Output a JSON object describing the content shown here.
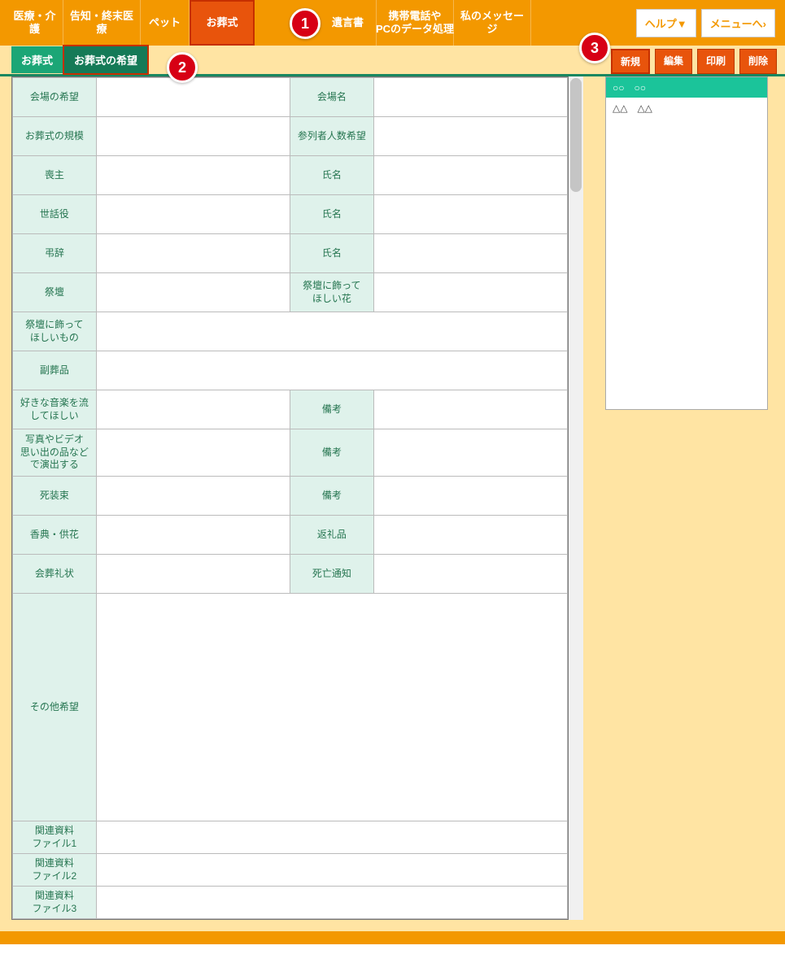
{
  "topnav": {
    "items": [
      "医療・介護",
      "告知・終末医療",
      "ペット",
      "お葬式",
      "",
      "遺言書",
      "携帯電話や\nPCのデータ処理",
      "私のメッセージ"
    ],
    "active_index": 3,
    "help": "ヘルプ▼",
    "menu": "メニューへ›"
  },
  "subtabs": {
    "items": [
      "お葬式",
      "お葬式の希望"
    ],
    "active_index": 1
  },
  "action_buttons": [
    "新規",
    "編集",
    "印刷",
    "削除"
  ],
  "callouts": [
    "1",
    "2",
    "3"
  ],
  "form_rows": [
    {
      "l1": "会場の希望",
      "l2": "会場名"
    },
    {
      "l1": "お葬式の規模",
      "l2": "参列者人数希望"
    },
    {
      "l1": "喪主",
      "l2": "氏名"
    },
    {
      "l1": "世話役",
      "l2": "氏名"
    },
    {
      "l1": "弔辞",
      "l2": "氏名"
    },
    {
      "l1": "祭壇",
      "l2": "祭壇に飾って\nほしい花"
    }
  ],
  "wide_rows": [
    "祭壇に飾って\nほしいもの",
    "副葬品"
  ],
  "form_rows2": [
    {
      "l1": "好きな音楽を流\nしてほしい",
      "l2": "備考"
    },
    {
      "l1": "写真やビデオ\n思い出の品など\nで演出する",
      "l2": "備考",
      "h": 58
    },
    {
      "l1": "死装束",
      "l2": "備考"
    },
    {
      "l1": "香典・供花",
      "l2": "返礼品"
    },
    {
      "l1": "会葬礼状",
      "l2": "死亡通知"
    }
  ],
  "other_label": "その他希望",
  "file_rows": [
    "関連資料\nファイル1",
    "関連資料\nファイル2",
    "関連資料\nファイル3"
  ],
  "side_list": {
    "header": "○○　○○",
    "items": [
      "△△　△△"
    ]
  }
}
